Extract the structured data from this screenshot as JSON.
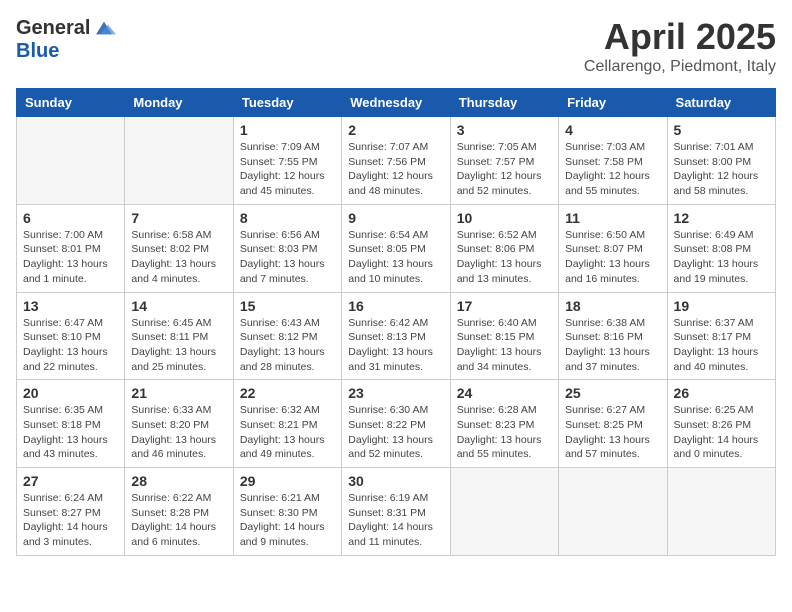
{
  "logo": {
    "general": "General",
    "blue": "Blue"
  },
  "title": "April 2025",
  "location": "Cellarengo, Piedmont, Italy",
  "weekdays": [
    "Sunday",
    "Monday",
    "Tuesday",
    "Wednesday",
    "Thursday",
    "Friday",
    "Saturday"
  ],
  "weeks": [
    [
      {
        "day": "",
        "info": ""
      },
      {
        "day": "",
        "info": ""
      },
      {
        "day": "1",
        "info": "Sunrise: 7:09 AM\nSunset: 7:55 PM\nDaylight: 12 hours and 45 minutes."
      },
      {
        "day": "2",
        "info": "Sunrise: 7:07 AM\nSunset: 7:56 PM\nDaylight: 12 hours and 48 minutes."
      },
      {
        "day": "3",
        "info": "Sunrise: 7:05 AM\nSunset: 7:57 PM\nDaylight: 12 hours and 52 minutes."
      },
      {
        "day": "4",
        "info": "Sunrise: 7:03 AM\nSunset: 7:58 PM\nDaylight: 12 hours and 55 minutes."
      },
      {
        "day": "5",
        "info": "Sunrise: 7:01 AM\nSunset: 8:00 PM\nDaylight: 12 hours and 58 minutes."
      }
    ],
    [
      {
        "day": "6",
        "info": "Sunrise: 7:00 AM\nSunset: 8:01 PM\nDaylight: 13 hours and 1 minute."
      },
      {
        "day": "7",
        "info": "Sunrise: 6:58 AM\nSunset: 8:02 PM\nDaylight: 13 hours and 4 minutes."
      },
      {
        "day": "8",
        "info": "Sunrise: 6:56 AM\nSunset: 8:03 PM\nDaylight: 13 hours and 7 minutes."
      },
      {
        "day": "9",
        "info": "Sunrise: 6:54 AM\nSunset: 8:05 PM\nDaylight: 13 hours and 10 minutes."
      },
      {
        "day": "10",
        "info": "Sunrise: 6:52 AM\nSunset: 8:06 PM\nDaylight: 13 hours and 13 minutes."
      },
      {
        "day": "11",
        "info": "Sunrise: 6:50 AM\nSunset: 8:07 PM\nDaylight: 13 hours and 16 minutes."
      },
      {
        "day": "12",
        "info": "Sunrise: 6:49 AM\nSunset: 8:08 PM\nDaylight: 13 hours and 19 minutes."
      }
    ],
    [
      {
        "day": "13",
        "info": "Sunrise: 6:47 AM\nSunset: 8:10 PM\nDaylight: 13 hours and 22 minutes."
      },
      {
        "day": "14",
        "info": "Sunrise: 6:45 AM\nSunset: 8:11 PM\nDaylight: 13 hours and 25 minutes."
      },
      {
        "day": "15",
        "info": "Sunrise: 6:43 AM\nSunset: 8:12 PM\nDaylight: 13 hours and 28 minutes."
      },
      {
        "day": "16",
        "info": "Sunrise: 6:42 AM\nSunset: 8:13 PM\nDaylight: 13 hours and 31 minutes."
      },
      {
        "day": "17",
        "info": "Sunrise: 6:40 AM\nSunset: 8:15 PM\nDaylight: 13 hours and 34 minutes."
      },
      {
        "day": "18",
        "info": "Sunrise: 6:38 AM\nSunset: 8:16 PM\nDaylight: 13 hours and 37 minutes."
      },
      {
        "day": "19",
        "info": "Sunrise: 6:37 AM\nSunset: 8:17 PM\nDaylight: 13 hours and 40 minutes."
      }
    ],
    [
      {
        "day": "20",
        "info": "Sunrise: 6:35 AM\nSunset: 8:18 PM\nDaylight: 13 hours and 43 minutes."
      },
      {
        "day": "21",
        "info": "Sunrise: 6:33 AM\nSunset: 8:20 PM\nDaylight: 13 hours and 46 minutes."
      },
      {
        "day": "22",
        "info": "Sunrise: 6:32 AM\nSunset: 8:21 PM\nDaylight: 13 hours and 49 minutes."
      },
      {
        "day": "23",
        "info": "Sunrise: 6:30 AM\nSunset: 8:22 PM\nDaylight: 13 hours and 52 minutes."
      },
      {
        "day": "24",
        "info": "Sunrise: 6:28 AM\nSunset: 8:23 PM\nDaylight: 13 hours and 55 minutes."
      },
      {
        "day": "25",
        "info": "Sunrise: 6:27 AM\nSunset: 8:25 PM\nDaylight: 13 hours and 57 minutes."
      },
      {
        "day": "26",
        "info": "Sunrise: 6:25 AM\nSunset: 8:26 PM\nDaylight: 14 hours and 0 minutes."
      }
    ],
    [
      {
        "day": "27",
        "info": "Sunrise: 6:24 AM\nSunset: 8:27 PM\nDaylight: 14 hours and 3 minutes."
      },
      {
        "day": "28",
        "info": "Sunrise: 6:22 AM\nSunset: 8:28 PM\nDaylight: 14 hours and 6 minutes."
      },
      {
        "day": "29",
        "info": "Sunrise: 6:21 AM\nSunset: 8:30 PM\nDaylight: 14 hours and 9 minutes."
      },
      {
        "day": "30",
        "info": "Sunrise: 6:19 AM\nSunset: 8:31 PM\nDaylight: 14 hours and 11 minutes."
      },
      {
        "day": "",
        "info": ""
      },
      {
        "day": "",
        "info": ""
      },
      {
        "day": "",
        "info": ""
      }
    ]
  ]
}
